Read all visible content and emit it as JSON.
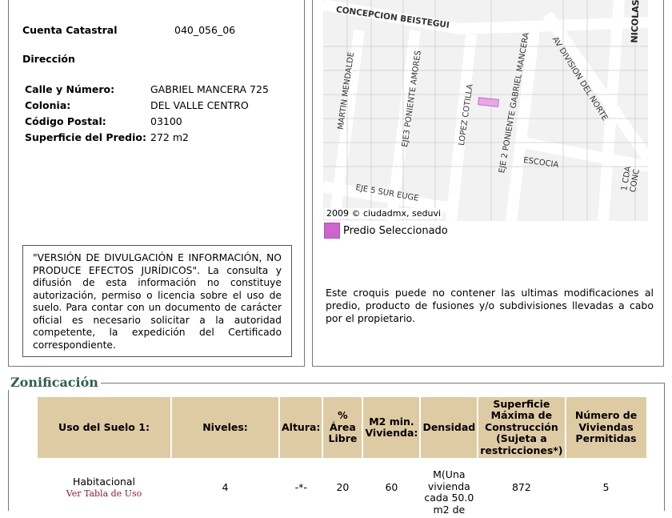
{
  "predio": {
    "cuenta_label": "Cuenta Catastral",
    "cuenta_value": "040_056_06",
    "direccion_label": "Dirección",
    "fields": [
      {
        "label": "Calle y Número:",
        "value": "GABRIEL MANCERA 725"
      },
      {
        "label": "Colonia:",
        "value": "DEL VALLE CENTRO"
      },
      {
        "label": "Código Postal:",
        "value": "03100"
      },
      {
        "label": "Superficie del Predio:",
        "value": "272 m2"
      }
    ],
    "notice": "\"VERSIÓN DE DIVULGACIÓN E INFORMACIÓN, NO PRODUCE EFECTOS JURÍDICOS\". La consulta y difusión de esta información no constituye autorización, permiso o licencia sobre el uso de suelo. Para contar con un documento de carácter oficial es necesario solicitar a la autoridad competente, la expedición del Certificado correspondiente."
  },
  "map": {
    "streets": [
      "CONCEPCION BEISTEGUI",
      "MARTIN MENDALDE",
      "EJE3 PONIENTE AMORES",
      "LOPEZ COTILLA",
      "EJE 2 PONIENTE GABRIEL MANCERA",
      "AV DIVISION DEL NORTE",
      "NICOLAS",
      "ESCOCIA",
      "EJE 5 SUR EUGE",
      "1 CDA CONC"
    ],
    "copyright": "2009 © ciudadmx, seduvi",
    "legend": "Predio Seleccionado",
    "legend_color": "#cc66cc",
    "note": "Este croquis puede no contener las ultimas modificaciones al predio, producto de fusiones y/o subdivisiones llevadas a cabo por el propietario."
  },
  "zonificacion": {
    "title": "Zonificación",
    "headers": [
      "Uso del Suelo 1:",
      "Niveles:",
      "Altura:",
      "% Área Libre",
      "M2 min. Vivienda:",
      "Densidad",
      "Superficie Máxima de Construcción (Sujeta a restricciones*)",
      "Número de Viviendas Permitidas"
    ],
    "row": {
      "uso": "Habitacional",
      "link": "Ver Tabla de Uso",
      "niveles": "4",
      "altura": "-*-",
      "area_libre": "20",
      "m2_min": "60",
      "densidad": "M(Una vivienda cada 50.0 m2 de",
      "superficie": "872",
      "viviendas": "5"
    },
    "header_color": "#dfcba3"
  }
}
